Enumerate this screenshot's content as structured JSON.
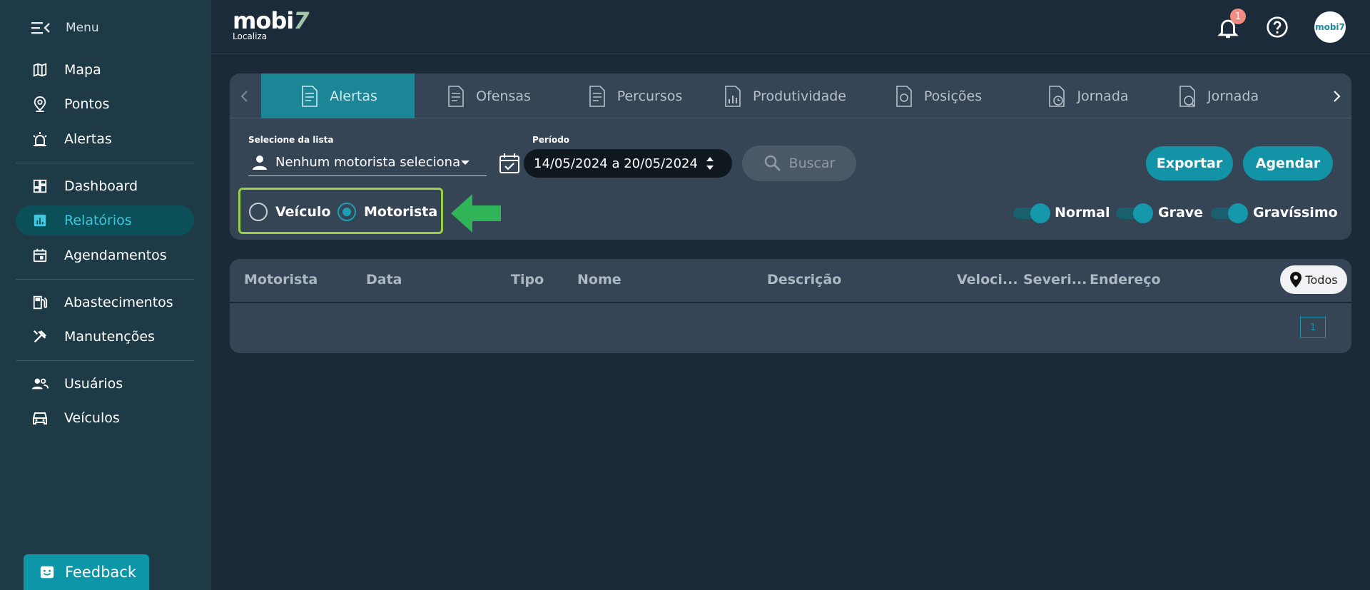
{
  "sidebar": {
    "menu_label": "Menu",
    "items": [
      {
        "label": "Mapa",
        "icon": "map-icon"
      },
      {
        "label": "Pontos",
        "icon": "location-pin-icon"
      },
      {
        "label": "Alertas",
        "icon": "siren-icon"
      },
      {
        "label": "Dashboard",
        "icon": "dashboard-icon"
      },
      {
        "label": "Relatórios",
        "icon": "bar-chart-icon",
        "active": true
      },
      {
        "label": "Agendamentos",
        "icon": "calendar-icon"
      },
      {
        "label": "Abastecimentos",
        "icon": "fuel-pump-icon"
      },
      {
        "label": "Manutenções",
        "icon": "tools-icon"
      },
      {
        "label": "Usuários",
        "icon": "users-icon"
      },
      {
        "label": "Veículos",
        "icon": "car-icon"
      }
    ],
    "feedback_label": "Feedback"
  },
  "topbar": {
    "brand_main": "mobi",
    "brand_seven": "7",
    "brand_sub": "Localiza",
    "notification_count": "1",
    "avatar_text": "mobi7"
  },
  "tabs": [
    {
      "label": "Alertas",
      "active": true
    },
    {
      "label": "Ofensas"
    },
    {
      "label": "Percursos"
    },
    {
      "label": "Produtividade"
    },
    {
      "label": "Posições"
    },
    {
      "label": "Jornada"
    },
    {
      "label": "Jornada"
    }
  ],
  "filters": {
    "list_label": "Selecione da lista",
    "list_value": "Nenhum motorista selecionado",
    "period_label": "Período",
    "period_value": "14/05/2024 a 20/05/2024",
    "search_label": "Buscar",
    "export_label": "Exportar",
    "schedule_label": "Agendar",
    "radio_vehicle": "Veículo",
    "radio_driver": "Motorista",
    "selected_radio": "Motorista",
    "toggles": [
      {
        "label": "Normal",
        "on": true
      },
      {
        "label": "Grave",
        "on": true
      },
      {
        "label": "Gravíssimo",
        "on": true
      }
    ]
  },
  "table": {
    "columns": [
      "Motorista",
      "Data",
      "Tipo",
      "Nome",
      "Descrição",
      "Veloci...",
      "Severi...",
      "Endereço"
    ],
    "todos_label": "Todos",
    "page": "1"
  },
  "colors": {
    "accent": "#1294a6",
    "sidebar_bg": "#1e3a47",
    "highlight_border": "#9ad049",
    "arrow": "#2fb457"
  }
}
